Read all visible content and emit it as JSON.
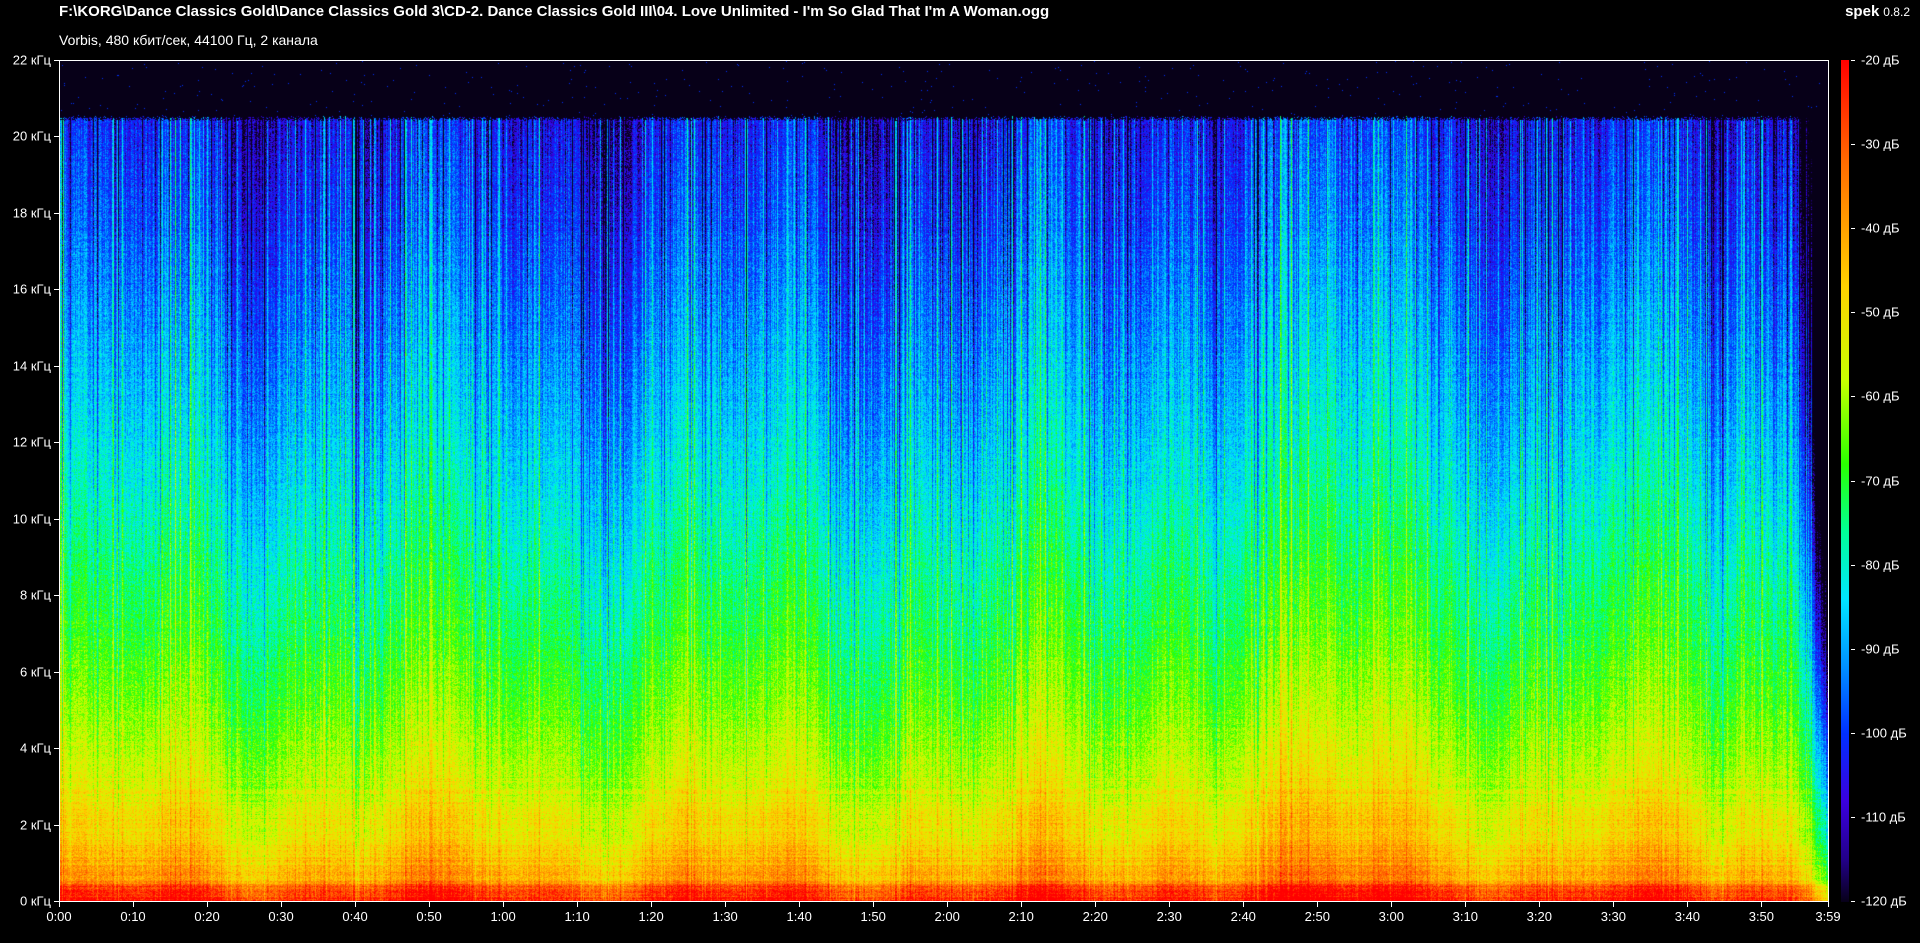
{
  "header": {
    "file_path": "F:\\KORG\\Dance Classics Gold\\Dance Classics Gold 3\\CD-2. Dance Classics Gold III\\04. Love Unlimited - I'm So Glad That I'm A Woman.ogg",
    "file_info": "Vorbis, 480 кбит/сек, 44100 Гц, 2 канала"
  },
  "brand": {
    "name": "spek",
    "version": "0.8.2"
  },
  "chart_data": {
    "type": "heatmap",
    "title": "",
    "xlabel": "",
    "ylabel": "",
    "x_unit": "time",
    "y_unit": "kHz",
    "duration": "3:59",
    "frequency_range_khz": [
      0,
      22
    ],
    "y_ticks": [
      "0 кГц",
      "2 кГц",
      "4 кГц",
      "6 кГц",
      "8 кГц",
      "10 кГц",
      "12 кГц",
      "14 кГц",
      "16 кГц",
      "18 кГц",
      "20 кГц",
      "22 кГц"
    ],
    "y_tick_values": [
      0,
      2,
      4,
      6,
      8,
      10,
      12,
      14,
      16,
      18,
      20,
      22
    ],
    "x_ticks": [
      "0:00",
      "0:10",
      "0:20",
      "0:30",
      "0:40",
      "0:50",
      "1:00",
      "1:10",
      "1:20",
      "1:30",
      "1:40",
      "1:50",
      "2:00",
      "2:10",
      "2:20",
      "2:30",
      "2:40",
      "2:50",
      "3:00",
      "3:10",
      "3:20",
      "3:30",
      "3:40",
      "3:50",
      "3:59"
    ],
    "x_tick_values": [
      0,
      10,
      20,
      30,
      40,
      50,
      60,
      70,
      80,
      90,
      100,
      110,
      120,
      130,
      140,
      150,
      160,
      170,
      180,
      190,
      200,
      210,
      220,
      230,
      239
    ],
    "x_range_seconds": [
      0,
      239
    ],
    "colorbar": {
      "range_db": [
        -120,
        -20
      ],
      "ticks": [
        "-20 дБ",
        "-30 дБ",
        "-40 дБ",
        "-50 дБ",
        "-60 дБ",
        "-70 дБ",
        "-80 дБ",
        "-90 дБ",
        "-100 дБ",
        "-110 дБ",
        "-120 дБ"
      ],
      "tick_values": [
        -20,
        -30,
        -40,
        -50,
        -60,
        -70,
        -80,
        -90,
        -100,
        -110,
        -120
      ],
      "colors": [
        "#ff0000",
        "#ff6a00",
        "#ffd200",
        "#c8ff00",
        "#2aff00",
        "#00ff96",
        "#00e6ff",
        "#0091ff",
        "#0030ff",
        "#3a00e0",
        "#070018"
      ]
    },
    "content_cutoff_khz": 20.5
  }
}
